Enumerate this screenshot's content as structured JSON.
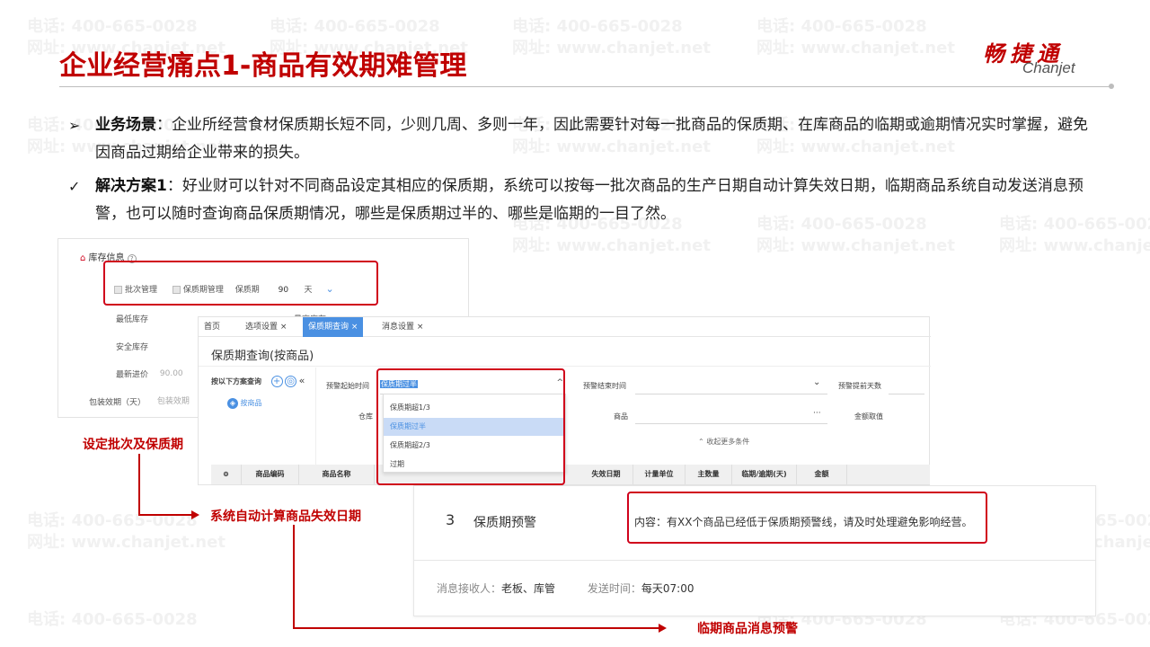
{
  "watermark": {
    "phone": "电话: 400-665-0028",
    "site": "网址: www.chanjet.net"
  },
  "header": {
    "title": "企业经营痛点1-商品有效期难管理",
    "logo_cn": "畅捷通",
    "logo_en": "Chanjet"
  },
  "bullets": [
    {
      "mark": "➢",
      "label": "业务场景",
      "text": "：企业所经营食材保质期长短不同，少则几周、多则一年，因此需要针对每一批商品的保质期、在库商品的临期或逾期情况实时掌握，避免因商品过期给企业带来的损失。"
    },
    {
      "mark": "✓",
      "label": "解决方案1",
      "text": "：好业财可以针对不同商品设定其相应的保质期，系统可以按每一批次商品的生产日期自动计算失效日期，临期商品系统自动发送消息预警，也可以随时查询商品保质期情况，哪些是保质期过半的、哪些是临期的一目了然。"
    }
  ],
  "inventory_panel": {
    "section_title": "库存信息",
    "help_icon": "?",
    "batch_label": "批次管理",
    "shelf_label": "保质期管理",
    "period_label": "保质期",
    "period_value": "90",
    "period_unit": "天",
    "min_stock": "最低库存",
    "max_stock": "最高库存",
    "safe_stock": "安全库存",
    "latest_price_label": "最新进价",
    "latest_price_value": "90.00",
    "package_label": "包装效期（天）",
    "package_placeholder": "包装效期"
  },
  "query_panel": {
    "tabs": [
      {
        "label": "首页",
        "active": false
      },
      {
        "label": "选项设置 ×",
        "active": false
      },
      {
        "label": "保质期查询 ×",
        "active": true
      },
      {
        "label": "消息设置 ×",
        "active": false
      }
    ],
    "title": "保质期查询(按商品)",
    "scheme_label": "按以下方案查询",
    "by_goods": "按商品",
    "warn_start_label": "预警起始时间",
    "warn_start_value": "保质期过半",
    "warn_end_label": "预警结束时间",
    "advance_days_label": "预警提前天数",
    "warehouse_label": "仓库",
    "goods_label": "商品",
    "amount_label": "金额取值",
    "collapse_label": "收起更多条件",
    "dropdown_options": [
      {
        "label": "保质期超1/3",
        "selected": false
      },
      {
        "label": "保质期过半",
        "selected": true
      },
      {
        "label": "保质期超2/3",
        "selected": false
      },
      {
        "label": "过期",
        "selected": false
      }
    ],
    "table_headers": [
      "商品编码",
      "商品名称",
      "失效日期",
      "计量单位",
      "主数量",
      "临期/逾期(天)",
      "金额"
    ]
  },
  "message_panel": {
    "index": "3",
    "name": "保质期预警",
    "content": "内容：有XX个商品已经低于保质期预警线，请及时处理避免影响经营。",
    "receivers_label": "消息接收人：",
    "receivers_value": "老板、库管",
    "send_time_label": "发送时间：",
    "send_time_value": "每天07:00"
  },
  "annotations": {
    "set_batch": "设定批次及保质期",
    "auto_calc": "系统自动计算商品失效日期",
    "expiry_msg": "临期商品消息预警"
  },
  "colors": {
    "accent_red": "#c00000",
    "box_red": "#d0021b",
    "ui_blue": "#4a90e2"
  }
}
